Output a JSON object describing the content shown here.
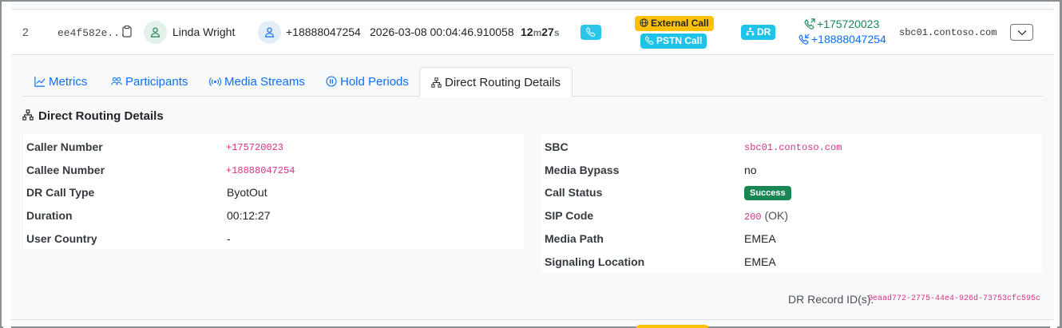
{
  "row": {
    "index": "2",
    "call_id": "ee4f582e...",
    "user_name": "Linda Wright",
    "phone": "+18888047254",
    "timestamp": "2026-03-08 00:04:46.910058",
    "duration_minutes": "12",
    "duration_m_unit": "m",
    "duration_seconds": "27",
    "duration_s_unit": "s",
    "badges": {
      "external_call": "External Call",
      "pstn_call": "PSTN Call",
      "dr": "DR"
    },
    "caller": "+175720023",
    "callee": "+18888047254",
    "sbc": "sbc01.contoso.com"
  },
  "tabs": [
    {
      "label": "Metrics",
      "icon": "chart-line-icon"
    },
    {
      "label": "Participants",
      "icon": "people-icon"
    },
    {
      "label": "Media Streams",
      "icon": "broadcast-icon"
    },
    {
      "label": "Hold Periods",
      "icon": "pause-circle-icon"
    },
    {
      "label": "Direct Routing Details",
      "icon": "diagram-icon",
      "active": true
    }
  ],
  "section": {
    "title": "Direct Routing Details"
  },
  "left_fields": [
    {
      "label": "Caller Number",
      "value": "+175720023"
    },
    {
      "label": "Callee Number",
      "value": "+18888047254"
    },
    {
      "label": "DR Call Type",
      "value": "ByotOut"
    },
    {
      "label": "Duration",
      "value": "00:12:27"
    },
    {
      "label": "User Country",
      "value": "-"
    }
  ],
  "right_fields": [
    {
      "label": "SBC",
      "value": "sbc01.contoso.com"
    },
    {
      "label": "Media Bypass",
      "value": "no"
    },
    {
      "label": "Call Status",
      "value": "Success"
    },
    {
      "label": "SIP Code",
      "code": "200",
      "text": "(OK)"
    },
    {
      "label": "Media Path",
      "value": "EMEA"
    },
    {
      "label": "Signaling Location",
      "value": "EMEA"
    }
  ],
  "record": {
    "label": "DR Record ID(s):",
    "id": "2eaad772-2775-44e4-926d-73753cfc595c"
  },
  "colors": {
    "link_blue": "#0d6efd",
    "success_green": "#198754",
    "warning_yellow": "#ffc107",
    "info_cyan": "#1fc3e9",
    "code_pink": "#d63384"
  }
}
